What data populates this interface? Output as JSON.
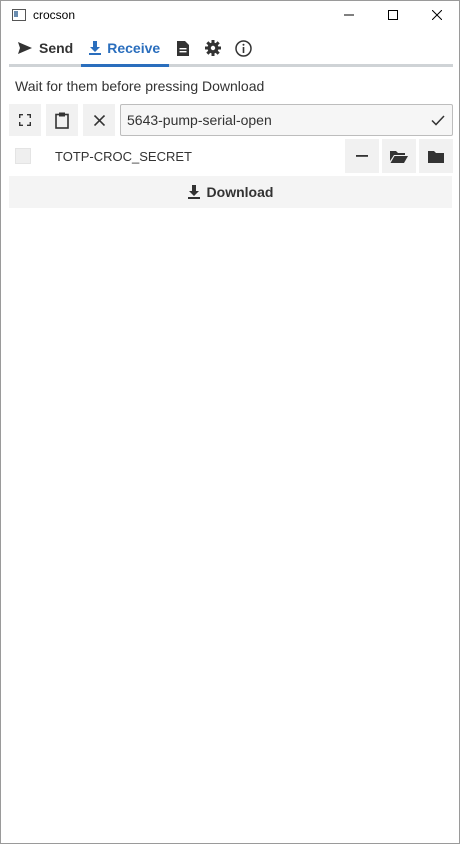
{
  "window": {
    "title": "crocson"
  },
  "tabs": [
    {
      "label": "Send",
      "icon": "send-icon"
    },
    {
      "label": "Receive",
      "icon": "download-icon"
    }
  ],
  "tab_icons": [
    "document-icon",
    "gear-icon",
    "info-icon"
  ],
  "hint": "Wait for them before pressing Download",
  "code_input": {
    "value": "5643-pump-serial-open",
    "placeholder": ""
  },
  "file": {
    "label": "TOTP-CROC_SECRET"
  },
  "download_label": "Download",
  "colors": {
    "accent": "#2a6ebd",
    "button_bg": "#f1f1f1",
    "tab_rule": "#cfd3d6"
  }
}
